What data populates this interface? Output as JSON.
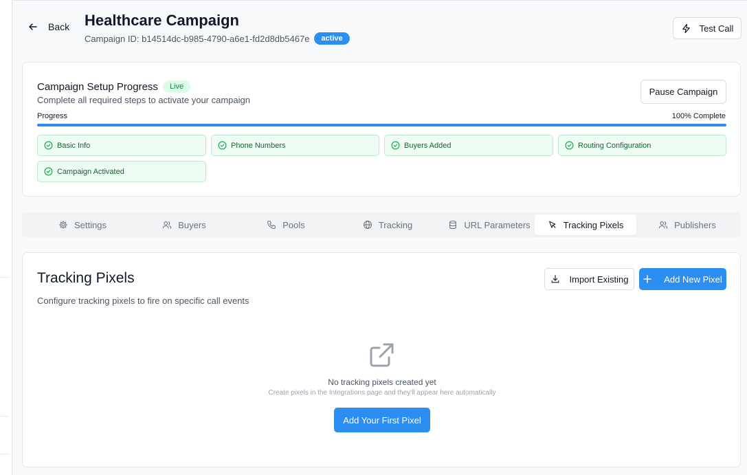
{
  "header": {
    "back_label": "Back",
    "title": "Healthcare Campaign",
    "campaign_id": "Campaign ID: b14514dc-b985-4790-a6e1-fd2d8db5467e",
    "status_badge": "active",
    "test_call_label": "Test Call"
  },
  "progress": {
    "title": "Campaign Setup Progress",
    "live_badge": "Live",
    "description": "Complete all required steps to activate your campaign",
    "pause_label": "Pause Campaign",
    "progress_label": "Progress",
    "percent_label": "100% Complete",
    "percent_value": 100,
    "steps": [
      {
        "label": "Basic Info"
      },
      {
        "label": "Phone Numbers"
      },
      {
        "label": "Buyers Added"
      },
      {
        "label": "Routing Configuration"
      },
      {
        "label": "Campaign Activated"
      }
    ]
  },
  "tabs": [
    {
      "label": "Settings",
      "icon": "gear-icon"
    },
    {
      "label": "Buyers",
      "icon": "users-icon"
    },
    {
      "label": "Pools",
      "icon": "phone-icon"
    },
    {
      "label": "Tracking",
      "icon": "globe-icon"
    },
    {
      "label": "URL Parameters",
      "icon": "database-icon"
    },
    {
      "label": "Tracking Pixels",
      "icon": "cursor-icon",
      "active": true
    },
    {
      "label": "Publishers",
      "icon": "users-icon"
    }
  ],
  "pixels": {
    "title": "Tracking Pixels",
    "description": "Configure tracking pixels to fire on specific call events",
    "import_label": "Import Existing",
    "add_label": "Add New Pixel",
    "empty_icon": "external-link-icon",
    "empty_title": "No tracking pixels created yet",
    "empty_subtitle": "Create pixels in the Integrations page and they'll appear here automatically",
    "first_pixel_label": "Add Your First Pixel"
  },
  "colors": {
    "accent": "#2b8ef0",
    "success_text": "#166534",
    "success_bg": "#effcf3"
  }
}
